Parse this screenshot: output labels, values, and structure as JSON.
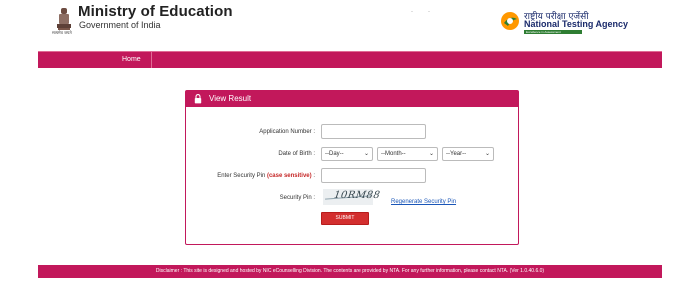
{
  "header": {
    "ministry_title": "Ministry of Education",
    "ministry_subtitle": "Government of India",
    "emblem_caption": "सत्यमेव जयते",
    "nta_hindi": "राष्ट्रीय परीक्षा एजेंसी",
    "nta_name": "National Testing Agency",
    "nta_tagline": "Excellence in Assessment"
  },
  "nav": {
    "home_label": "Home"
  },
  "card": {
    "title": "View Result",
    "application_number_label": "Application Number :",
    "application_number_value": "",
    "dob_label": "Date of Birth :",
    "dob_day": "--Day--",
    "dob_month": "--Month--",
    "dob_year": "--Year--",
    "security_pin_label_prefix": "Enter Security Pin ",
    "security_pin_label_emph": "(case sensitive)",
    "security_pin_label_suffix": " :",
    "security_pin_value": "",
    "captcha_label": "Security Pin :",
    "captcha_text": "10RM88",
    "regenerate_label": "Regenerate Security Pin",
    "submit_label": "SUBMIT"
  },
  "footer": {
    "disclaimer": "Disclaimer : This site is designed and hosted by NIC eCounselling Division. The contents are provided by NTA. For any further information, please contact NTA. (Ver 1.0.40.6.0)"
  },
  "colors": {
    "brand": "#c2185b",
    "submit": "#d32f2f",
    "nta_blue": "#1a2a6b",
    "link": "#1a56b8"
  },
  "icons": {
    "emblem": "state-emblem-icon",
    "nta": "nta-logo-icon",
    "lock": "lock-icon",
    "caret": "chevron-down-icon"
  }
}
